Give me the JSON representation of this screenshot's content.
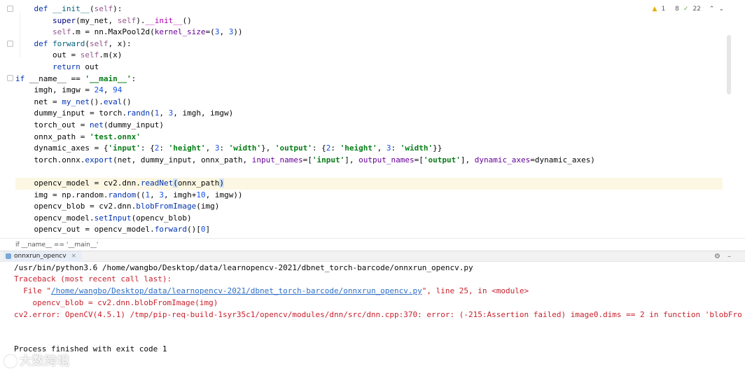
{
  "editor": {
    "inspection": {
      "warnings": "1",
      "weak_warnings": "8",
      "typos": "22"
    },
    "code": {
      "l1": {
        "kw": "def ",
        "fn": "__init__",
        "p1": "(",
        "self": "self",
        "p2": "):"
      },
      "l2": {
        "bi": "super",
        "t1": "(my_net, ",
        "self": "self",
        "t2": ").",
        "dun": "__init__",
        "t3": "()"
      },
      "l3": {
        "self": "self",
        "t1": ".m = nn.MaxPool2d(",
        "prm": "kernel_size",
        "t2": "=(",
        "n1": "3",
        "t3": ", ",
        "n2": "3",
        "t4": "))"
      },
      "l4": {
        "kw": "def ",
        "fn": "forward",
        "p1": "(",
        "self": "self",
        "t1": ", ",
        "x": "x",
        "t2": "):"
      },
      "l5": {
        "t1": "out = ",
        "self": "self",
        "t2": ".m(x)"
      },
      "l6": {
        "kw": "return ",
        "t1": "out"
      },
      "l7": {
        "kw": "if ",
        "t1": "__name__ == ",
        "str": "'__main__'",
        "t2": ":"
      },
      "l8": {
        "t1": "imgh, imgw = ",
        "n1": "24",
        "t2": ", ",
        "n2": "94"
      },
      "l9": {
        "t1": "net = ",
        "call": "my_net",
        "t2": "().",
        "call2": "eval",
        "t3": "()"
      },
      "l10": {
        "t1": "dummy_input = torch.",
        "call": "randn",
        "t2": "(",
        "n1": "1",
        "t3": ", ",
        "n2": "3",
        "t4": ", imgh, imgw)"
      },
      "l11": {
        "t1": "torch_out = ",
        "call": "net",
        "t2": "(dummy_input)"
      },
      "l12": {
        "t1": "onnx_path = ",
        "str": "'test.onnx'"
      },
      "l13": {
        "t1": "dynamic_axes = {",
        "s1": "'input'",
        "t2": ": {",
        "n1": "2",
        "t3": ": ",
        "s2": "'height'",
        "t4": ", ",
        "n2": "3",
        "t5": ": ",
        "s3": "'width'",
        "t6": "}, ",
        "s4": "'output'",
        "t7": ": {",
        "n3": "2",
        "t8": ": ",
        "s5": "'height'",
        "t9": ", ",
        "n4": "3",
        "t10": ": ",
        "s6": "'width'",
        "t11": "}}"
      },
      "l14": {
        "t1": "torch.onnx.",
        "call": "export",
        "t2": "(net, dummy_input, onnx_path, ",
        "p1": "input_names",
        "t3": "=[",
        "s1": "'input'",
        "t4": "], ",
        "p2": "output_names",
        "t5": "=[",
        "s2": "'output'",
        "t6": "], ",
        "p3": "dynamic_axes",
        "t7": "=dynamic_axes)"
      },
      "l15": {},
      "l16": {
        "t1": "opencv_model = cv2.dnn.",
        "call": "readNet",
        "b1": "(",
        "t2": "onnx_path",
        "b2": ")"
      },
      "l17": {
        "t1": "img = np.random.",
        "call": "random",
        "t2": "((",
        "n1": "1",
        "t3": ", ",
        "n2": "3",
        "t4": ", imgh+",
        "n3": "10",
        "t5": ", imgw))"
      },
      "l18": {
        "t1": "opencv_blob = cv2.dnn.",
        "call": "blobFromImage",
        "t2": "(img)"
      },
      "l19": {
        "t1": "opencv_model.",
        "call": "setInput",
        "t2": "(opencv_blob)"
      },
      "l20": {
        "t1": "opencv_out = opencv_model.",
        "call": "forward",
        "t2": "()[",
        "n1": "0",
        "t3": "]"
      }
    }
  },
  "breadcrumb": "if __name__ == '__main__'",
  "run": {
    "tab_label": "onnxrun_opencv",
    "close": "×",
    "settings_icon": "⚙",
    "minimize_icon": "–"
  },
  "console": {
    "line1": "/usr/bin/python3.6 /home/wangbo/Desktop/data/learnopencv-2021/dbnet_torch-barcode/onnxrun_opencv.py",
    "line2": "Traceback (most recent call last):",
    "line3_prefix": "  File \"",
    "line3_link": "/home/wangbo/Desktop/data/learnopencv-2021/dbnet_torch-barcode/onnxrun_opencv.py",
    "line3_suffix": "\", line 25, in <module>",
    "line4": "    opencv_blob = cv2.dnn.blobFromImage(img)",
    "line5": "cv2.error: OpenCV(4.5.1) /tmp/pip-req-build-1syr35c1/opencv/modules/dnn/src/dnn.cpp:370: error: (-215:Assertion failed) image0.dims == 2 in function 'blobFro",
    "line6": "Process finished with exit code 1"
  },
  "watermark": "大数跨境"
}
